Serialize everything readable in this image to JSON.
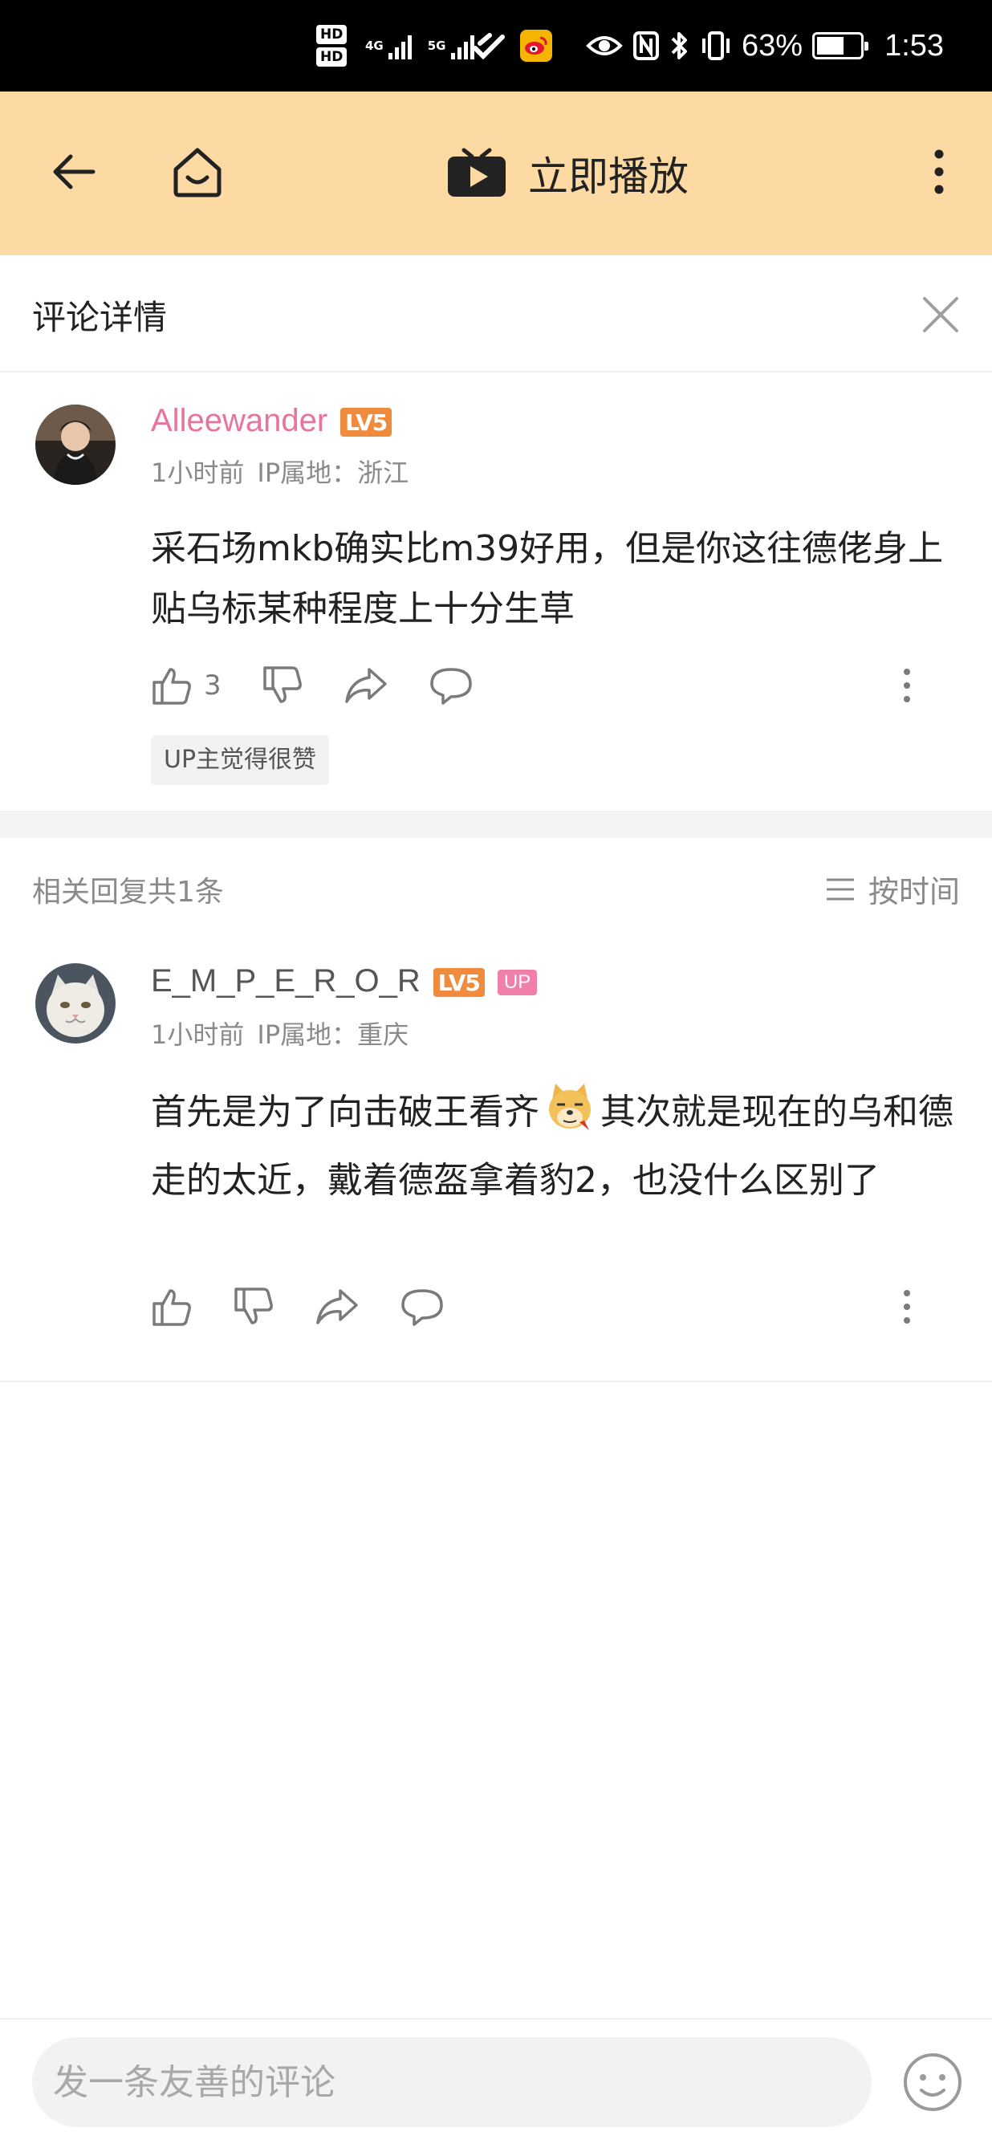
{
  "status_bar": {
    "hd1": "HD",
    "hd2": "HD",
    "net1": "4G",
    "net2": "5G",
    "battery_percent": "63%",
    "battery_level": 0.63,
    "time": "1:53"
  },
  "app_bar": {
    "title": "立即播放"
  },
  "detail": {
    "title": "评论详情"
  },
  "main_comment": {
    "username": "Alleewander",
    "level": "LV5",
    "time": "1小时前",
    "ip": "IP属地：浙江",
    "content": "采石场mkb确实比m39好用，但是你这往德佬身上贴乌标某种程度上十分生草",
    "likes": "3",
    "tag": "UP主觉得很赞"
  },
  "replies": {
    "count_label": "相关回复共1条",
    "sort_label": "按时间"
  },
  "reply": {
    "username": "E_M_P_E_R_O_R",
    "level": "LV5",
    "up_badge": "UP",
    "time": "1小时前",
    "ip": "IP属地：重庆",
    "content_part1": "首先是为了向击破王看齐",
    "content_part2": "其次就是现在的乌和德走的太近，戴着德盔拿着豹2，也没什么区别了"
  },
  "compose": {
    "placeholder": "发一条友善的评论"
  },
  "colors": {
    "appbar_bg": "#fdd9a4",
    "username_pink": "#e8749e",
    "level_orange": "#f08a3c",
    "up_pink": "#f17fab"
  }
}
